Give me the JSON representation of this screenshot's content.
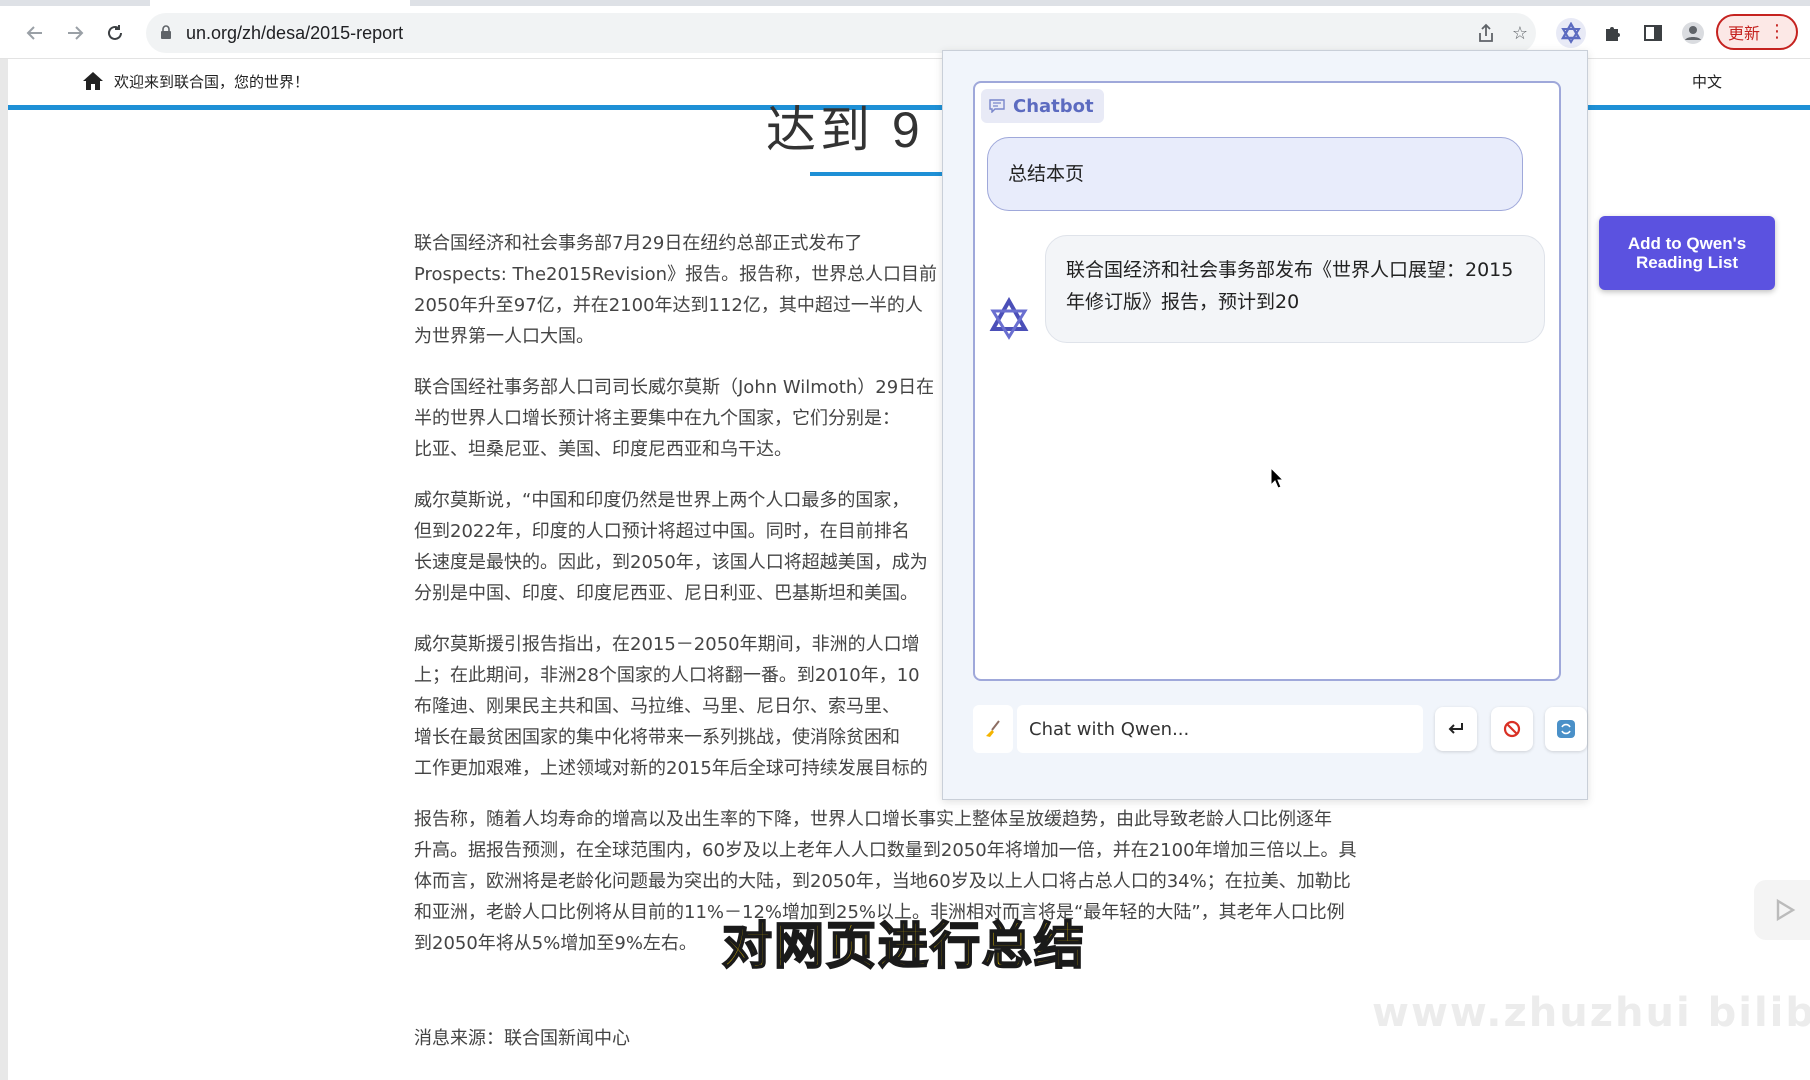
{
  "browser": {
    "url": "un.org/zh/desa/2015-report",
    "update_label": "更新"
  },
  "site": {
    "welcome": "欢迎来到联合国，您的世界！",
    "language": "中文"
  },
  "article": {
    "headline": "达到 9",
    "paragraphs": [
      [
        "联合国经济和社会事务部7月29日在纽约总部正式发布了",
        "Prospects: The2015Revision》报告。报告称，世界总人口目前",
        "2050年升至97亿，并在2100年达到112亿，其中超过一半的人",
        "为世界第一人口大国。"
      ],
      [
        "联合国经社事务部人口司司长威尔莫斯（John Wilmoth）29日在",
        "半的世界人口增长预计将主要集中在九个国家，它们分别是：",
        "比亚、坦桑尼亚、美国、印度尼西亚和乌干达。"
      ],
      [
        "威尔莫斯说，“中国和印度仍然是世界上两个人口最多的国家，",
        "但到2022年，印度的人口预计将超过中国。同时，在目前排名",
        "长速度是最快的。因此，到2050年，该国人口将超越美国，成为",
        "分别是中国、印度、印度尼西亚、尼日利亚、巴基斯坦和美国。"
      ],
      [
        "威尔莫斯援引报告指出，在2015－2050年期间，非洲的人口增",
        "上；在此期间，非洲28个国家的人口将翻一番。到2010年，10",
        "布隆迪、刚果民主共和国、马拉维、马里、尼日尔、索马里、",
        "增长在最贫困国家的集中化将带来一系列挑战，使消除贫困和",
        "工作更加艰难，上述领域对新的2015年后全球可持续发展目标的"
      ],
      [
        "报告称，随着人均寿命的增高以及出生率的下降，世界人口增长事实上整体呈放缓趋势，由此导致老龄人口比例逐年",
        "升高。据报告预测，在全球范围内，60岁及以上老年人人口数量到2050年将增加一倍，并在2100年增加三倍以上。具",
        "体而言，欧洲将是老龄化问题最为突出的大陆，到2050年，当地60岁及以上人口将占总人口的34%；在拉美、加勒比",
        "和亚洲，老龄人口比例将从目前的11%－12%增加到25%以上。非洲相对而言将是“最年轻的大陆”，其老年人口比例",
        "到2050年将从5%增加至9%左右。"
      ]
    ],
    "source": "消息来源：联合国新闻中心"
  },
  "chatbot": {
    "label": "Chatbot",
    "user_message": "总结本页",
    "bot_message": "联合国经济和社会事务部发布《世界人口展望：2015年修订版》报告，预计到20",
    "input_placeholder": "Chat with Qwen..."
  },
  "reading_list_button": "Add to Qwen's Reading List",
  "subtitle": "对网页进行总结",
  "watermark": "www.zhuzhui bilibili",
  "icons": {
    "back": "arrow-left-icon",
    "forward": "arrow-right-icon",
    "reload": "reload-icon",
    "lock": "lock-icon",
    "share": "share-icon",
    "bookmark": "star-icon",
    "extension": "qwen-logo-icon",
    "puzzle": "puzzle-icon",
    "sidepanel": "side-panel-icon",
    "profile": "profile-icon",
    "menu": "kebab-menu-icon",
    "home": "home-icon",
    "chat": "chat-bubble-icon",
    "clear": "broom-icon",
    "send": "enter-icon",
    "stop": "stop-icon",
    "refresh": "refresh-icon",
    "play": "play-icon"
  },
  "colors": {
    "accent_blue": "#1e90d6",
    "chat_accent": "#5c6bc0",
    "reading_list_bg": "#5b52e0",
    "subtitle_fill": "#ffd400",
    "update_red": "#c5221f"
  }
}
